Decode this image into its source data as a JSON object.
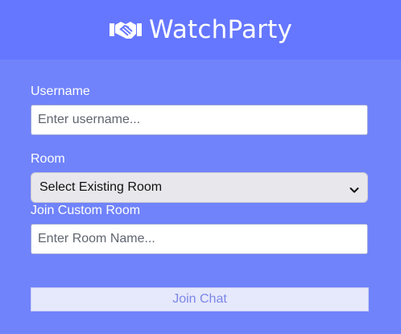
{
  "header": {
    "icon": "handshake-icon",
    "title": "WatchParty"
  },
  "form": {
    "username_label": "Username",
    "username_placeholder": "Enter username...",
    "room_label": "Room",
    "room_select_value": "Select Existing Room",
    "custom_room_label": "Join Custom Room",
    "custom_room_placeholder": "Enter Room Name...",
    "submit_label": "Join Chat"
  },
  "colors": {
    "page_bg": "#7083fb",
    "header_bg": "#6577ff",
    "button_bg": "#e6e8fb",
    "button_text": "#7b87e8"
  }
}
